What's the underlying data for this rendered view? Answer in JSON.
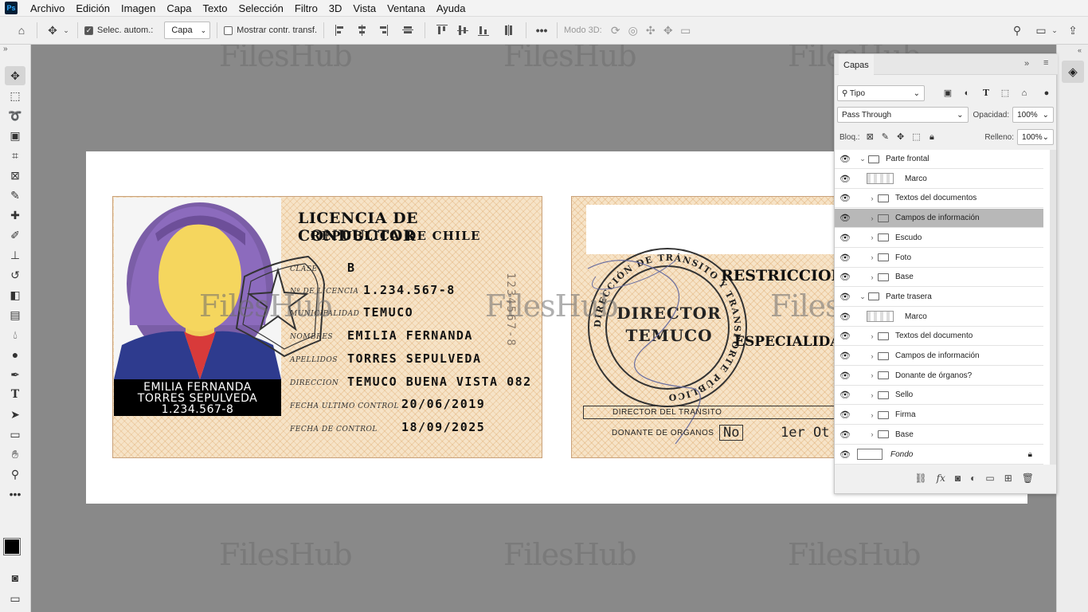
{
  "app": {
    "logo": "Ps"
  },
  "menu": [
    "Archivo",
    "Edición",
    "Imagen",
    "Capa",
    "Texto",
    "Selección",
    "Filtro",
    "3D",
    "Vista",
    "Ventana",
    "Ayuda"
  ],
  "options": {
    "auto_select_label": "Selec. autom.:",
    "auto_select_value": "Capa",
    "show_transform_label": "Mostrar contr. transf.",
    "mode3d_label": "Modo 3D:"
  },
  "watermark": "FilesHub",
  "card_front": {
    "title": "LICENCIA DE CONDUCTOR",
    "subtitle": "REPUBLICA DE CHILE",
    "name_lines": [
      "EMILIA FERNANDA",
      "TORRES SEPULVEDA",
      "1.234.567-8"
    ],
    "fields": [
      {
        "label": "CLASE",
        "value": "B"
      },
      {
        "label": "Nº DE LICENCIA",
        "value": "1.234.567-8"
      },
      {
        "label": "MUNICIPALIDAD",
        "value": "TEMUCO"
      },
      {
        "label": "NOMBRES",
        "value": "EMILIA FERNANDA"
      },
      {
        "label": "APELLIDOS",
        "value": "TORRES SEPULVEDA"
      },
      {
        "label": "DIRECCION",
        "value": "TEMUCO BUENA VISTA 082"
      },
      {
        "label": "FECHA ULTIMO CONTROL",
        "value": "20/06/2019"
      },
      {
        "label": "FECHA DE CONTROL",
        "value": "18/09/2025"
      }
    ],
    "vertical_number": "1234567-8"
  },
  "card_back": {
    "seal_ring": "DIRECCIÓN DE TRÁNSITO Y TRANSPORTE PÚBLICO",
    "seal_line1": "DIRECTOR",
    "seal_line2": "TEMUCO",
    "restrictions": "RESTRICCION",
    "specialty": "ESPECIALIDAD",
    "director_line": "DIRECTOR DEL TRANSITO",
    "donor_label": "DONANTE DE ORGANOS",
    "donor_value": "No",
    "extra": "1er Ot"
  },
  "layers_panel": {
    "tab": "Capas",
    "filter_type": "Tipo",
    "blend_mode": "Pass Through",
    "opacity_label": "Opacidad:",
    "opacity": "100%",
    "lock_label": "Bloq.:",
    "fill_label": "Relleno:",
    "fill": "100%",
    "layers": [
      {
        "name": "Parte frontal",
        "kind": "group-open",
        "indent": 0
      },
      {
        "name": "Marco",
        "kind": "smart",
        "indent": 1
      },
      {
        "name": "Textos del documentos",
        "kind": "group",
        "indent": 1
      },
      {
        "name": "Campos de información",
        "kind": "group",
        "indent": 1,
        "selected": true
      },
      {
        "name": "Escudo",
        "kind": "group",
        "indent": 1
      },
      {
        "name": "Foto",
        "kind": "group",
        "indent": 1
      },
      {
        "name": "Base",
        "kind": "group",
        "indent": 1
      },
      {
        "name": "Parte trasera",
        "kind": "group-open",
        "indent": 0
      },
      {
        "name": "Marco",
        "kind": "smart",
        "indent": 1
      },
      {
        "name": "Textos del documento",
        "kind": "group",
        "indent": 1
      },
      {
        "name": "Campos de información",
        "kind": "group",
        "indent": 1
      },
      {
        "name": "Donante de órganos?",
        "kind": "group",
        "indent": 1
      },
      {
        "name": "Sello",
        "kind": "group",
        "indent": 1
      },
      {
        "name": "Firma",
        "kind": "group",
        "indent": 1
      },
      {
        "name": "Base",
        "kind": "group",
        "indent": 1
      },
      {
        "name": "Fondo",
        "kind": "background",
        "indent": 0
      }
    ]
  }
}
